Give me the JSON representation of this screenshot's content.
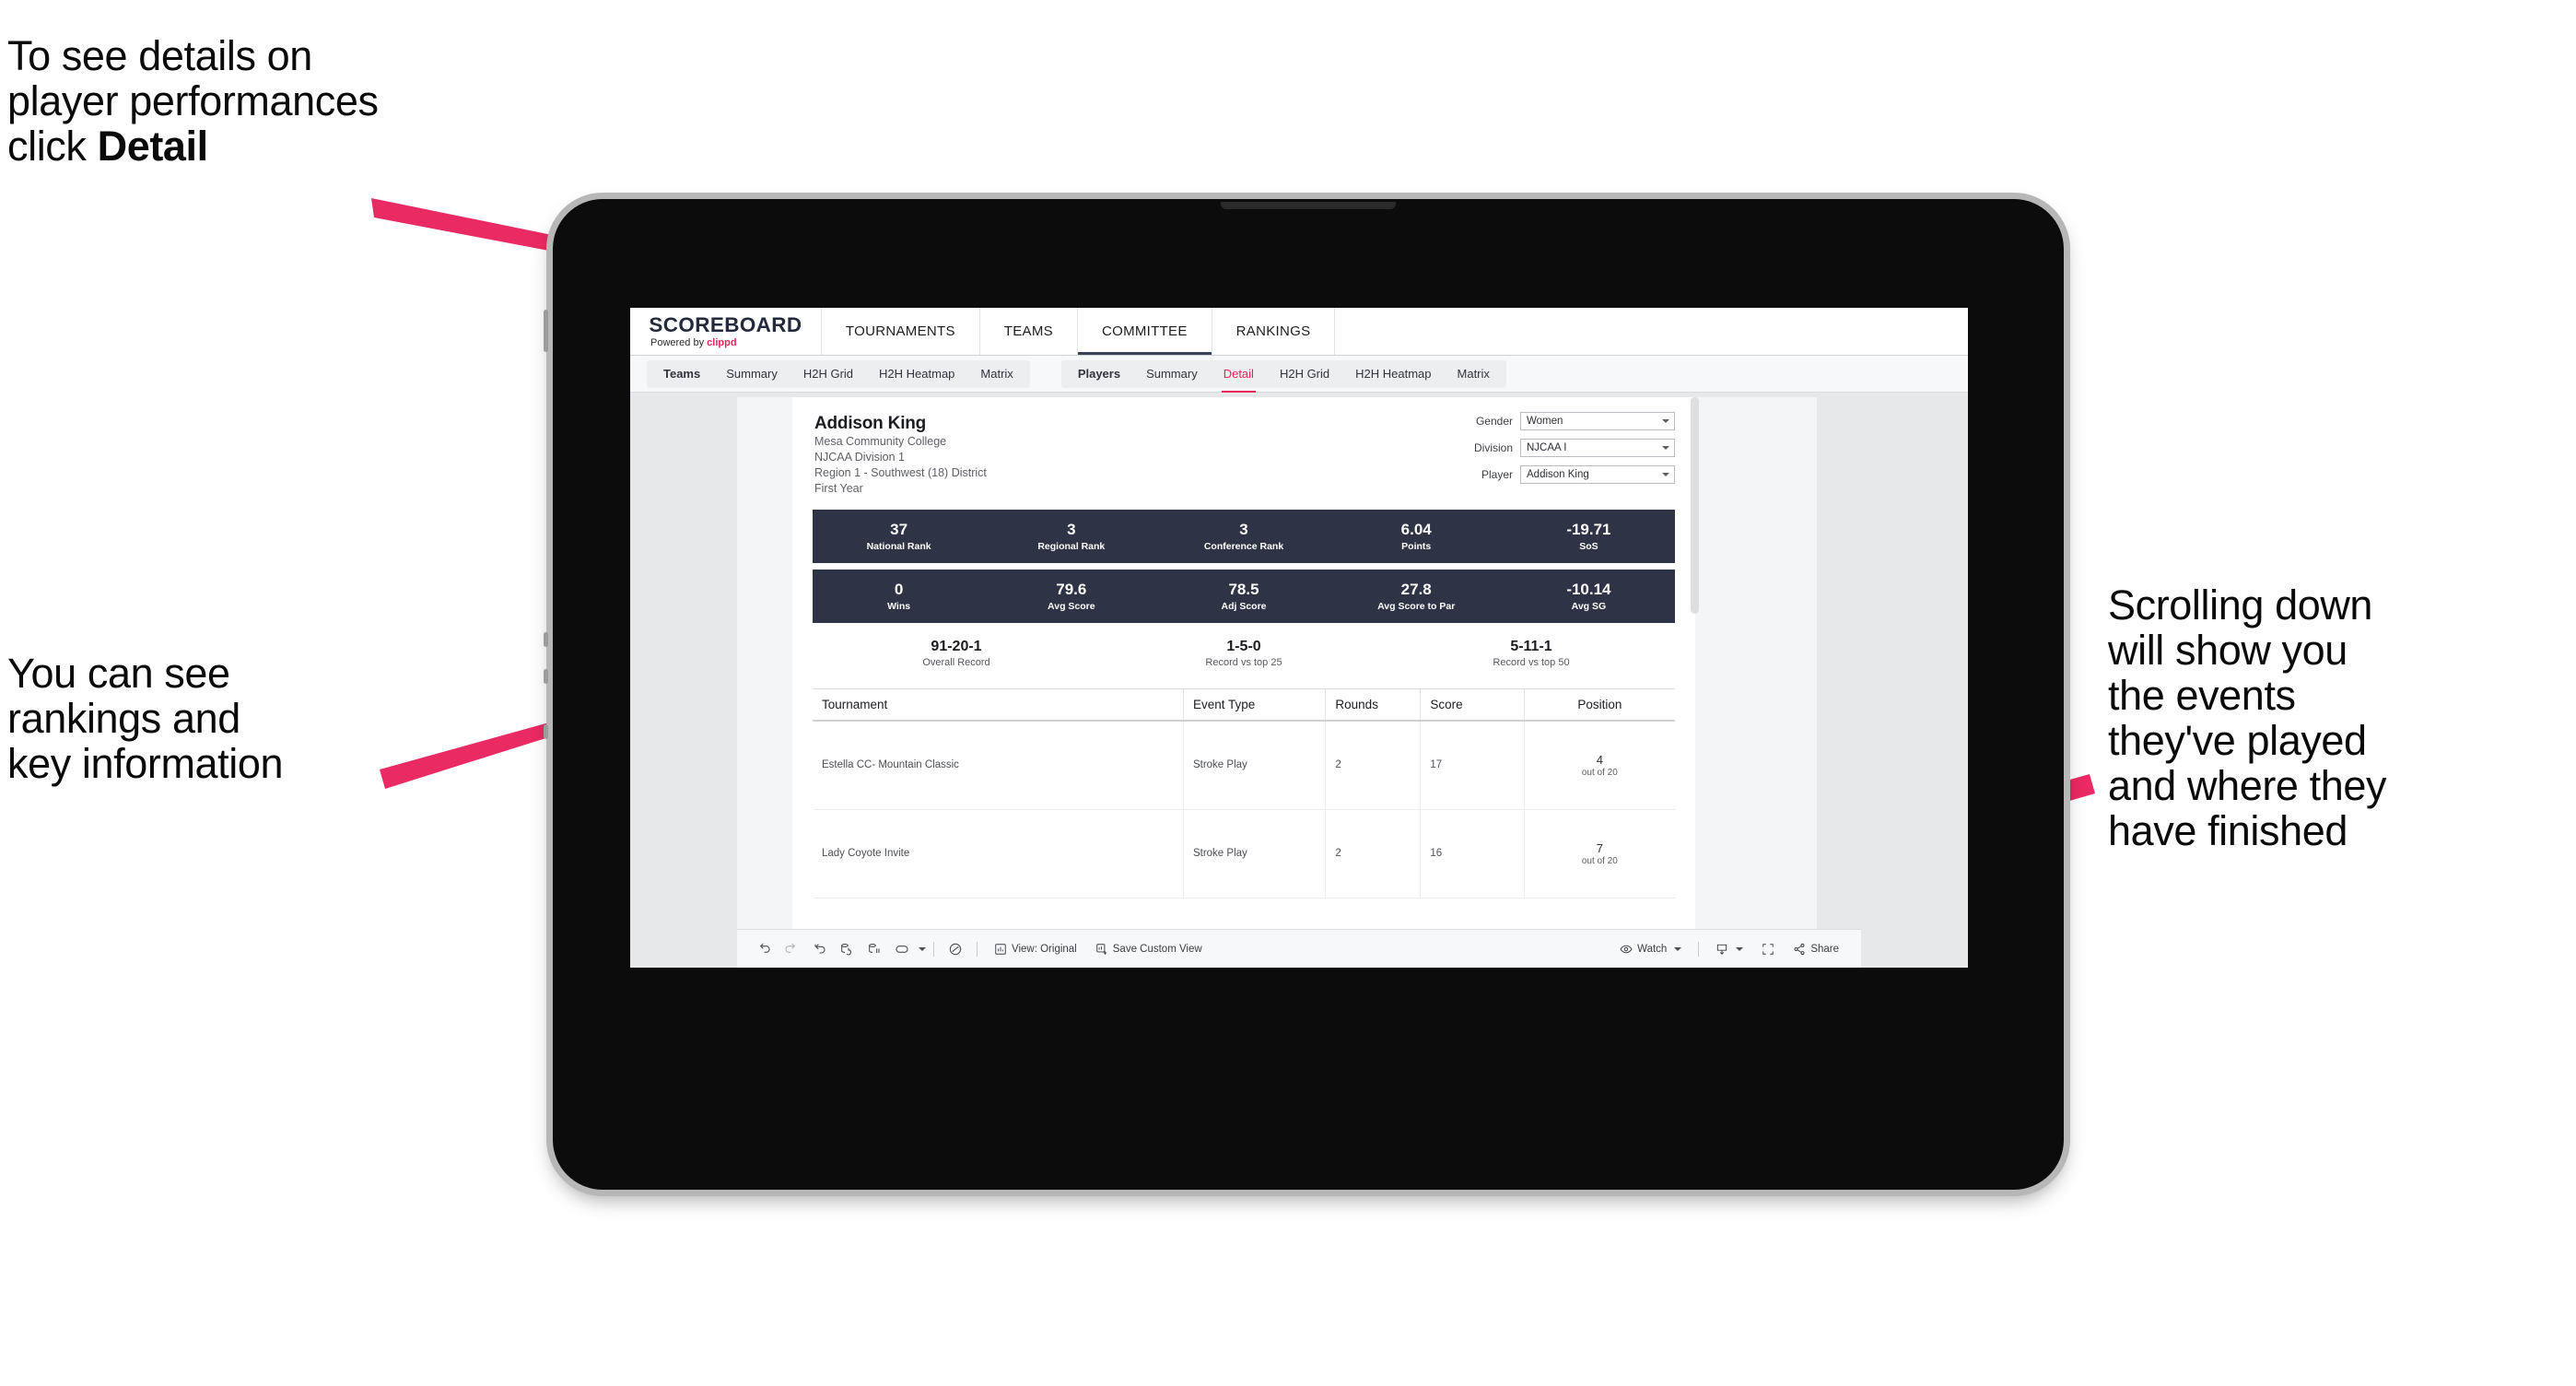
{
  "annotations": {
    "top_left": "To see details on\nplayer performances\nclick ",
    "top_left_bold": "Detail",
    "left": "You can see\nrankings and\nkey information",
    "right": "Scrolling down\nwill show you\nthe events\nthey've played\nand where they\nhave finished"
  },
  "colors": {
    "accent_pink": "#e8245b",
    "stat_navy": "#2e3446",
    "screen_bg": "#e7e8ea"
  },
  "app": {
    "logo_main": "SCOREBOARD",
    "logo_sub_prefix": "Powered by ",
    "logo_sub_brand": "clippd",
    "top_nav": [
      {
        "label": "TOURNAMENTS",
        "active": false
      },
      {
        "label": "TEAMS",
        "active": false
      },
      {
        "label": "COMMITTEE",
        "active": true
      },
      {
        "label": "RANKINGS",
        "active": false
      }
    ],
    "tab_group_teams": [
      {
        "label": "Teams",
        "active": false
      },
      {
        "label": "Summary",
        "active": false
      },
      {
        "label": "H2H Grid",
        "active": false
      },
      {
        "label": "H2H Heatmap",
        "active": false
      },
      {
        "label": "Matrix",
        "active": false
      }
    ],
    "tab_group_players": [
      {
        "label": "Players",
        "active": false
      },
      {
        "label": "Summary",
        "active": false
      },
      {
        "label": "Detail",
        "active": true
      },
      {
        "label": "H2H Grid",
        "active": false
      },
      {
        "label": "H2H Heatmap",
        "active": false
      },
      {
        "label": "Matrix",
        "active": false
      }
    ]
  },
  "player": {
    "name": "Addison King",
    "school": "Mesa Community College",
    "division": "NJCAA Division 1",
    "region": "Region 1 - Southwest (18) District",
    "year": "First Year"
  },
  "filters": [
    {
      "label": "Gender",
      "value": "Women"
    },
    {
      "label": "Division",
      "value": "NJCAA I"
    },
    {
      "label": "Player",
      "value": "Addison King"
    }
  ],
  "stats_row1": [
    {
      "value": "37",
      "label": "National Rank"
    },
    {
      "value": "3",
      "label": "Regional Rank"
    },
    {
      "value": "3",
      "label": "Conference Rank"
    },
    {
      "value": "6.04",
      "label": "Points"
    },
    {
      "value": "-19.71",
      "label": "SoS"
    }
  ],
  "stats_row2": [
    {
      "value": "0",
      "label": "Wins"
    },
    {
      "value": "79.6",
      "label": "Avg Score"
    },
    {
      "value": "78.5",
      "label": "Adj Score"
    },
    {
      "value": "27.8",
      "label": "Avg Score to Par"
    },
    {
      "value": "-10.14",
      "label": "Avg SG"
    }
  ],
  "records": [
    {
      "value": "91-20-1",
      "label": "Overall Record"
    },
    {
      "value": "1-5-0",
      "label": "Record vs top 25"
    },
    {
      "value": "5-11-1",
      "label": "Record vs top 50"
    }
  ],
  "table": {
    "columns": [
      "Tournament",
      "Event Type",
      "Rounds",
      "Score",
      "Position"
    ],
    "rows": [
      {
        "tournament": "Estella CC- Mountain Classic",
        "event_type": "Stroke Play",
        "rounds": "2",
        "score": "17",
        "position": "4",
        "position_of": "out of 20"
      },
      {
        "tournament": "Lady Coyote Invite",
        "event_type": "Stroke Play",
        "rounds": "2",
        "score": "16",
        "position": "7",
        "position_of": "out of 20"
      }
    ]
  },
  "toolbar": {
    "view_label": "View: Original",
    "save_label": "Save Custom View",
    "watch_label": "Watch",
    "share_label": "Share"
  }
}
